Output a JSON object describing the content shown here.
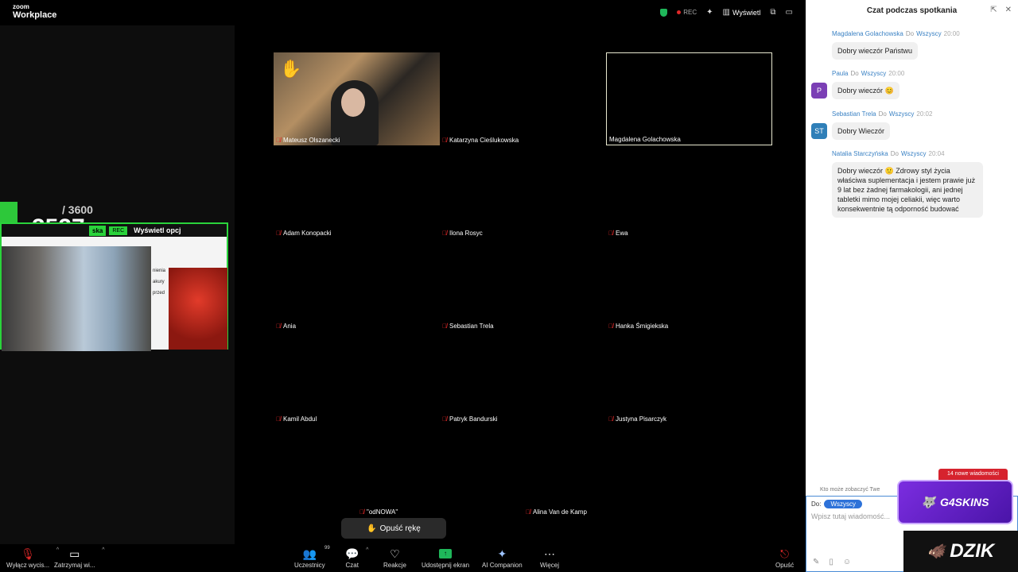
{
  "topbar": {
    "brand_small": "zoom",
    "brand_big": "Workplace",
    "rec": "REC",
    "view": "Wyświetl"
  },
  "overlay": {
    "counter_total": "/ 3600",
    "counter_now": "3537",
    "mini_name": "ska",
    "mini_rec": "REC",
    "mini_opts": "Wyświetl opcj",
    "doc_lines": [
      "nienia",
      "akury",
      "przed"
    ]
  },
  "participants": [
    {
      "name": "Mateusz Olszanecki",
      "hand": "✋"
    },
    {
      "name": "Katarzyna Cieślukowska"
    },
    {
      "name": "Magdalena Golachowska"
    },
    {
      "name": "Adam Konopacki"
    },
    {
      "name": "Ilona Rosyc"
    },
    {
      "name": "Ewa"
    },
    {
      "name": "Ania"
    },
    {
      "name": "Sebastian Trela"
    },
    {
      "name": "Hanka Śmigiekska"
    },
    {
      "name": "Kamil Abdul"
    },
    {
      "name": "Patryk Bandurski"
    },
    {
      "name": "Justyna Pisarczyk"
    },
    {
      "name": "\"odNOWA\""
    },
    {
      "name": "Alina Van de Kamp"
    }
  ],
  "lower_hand": "Opuść rękę",
  "toolbar": {
    "mute": "Wyłącz wycis...",
    "video": "Zatrzymaj wi...",
    "participants": "Uczestnicy",
    "participants_count": "99",
    "chat": "Czat",
    "reactions": "Reakcje",
    "share": "Udostępnij ekran",
    "ai": "AI Companion",
    "more": "Więcej",
    "leave": "Opuść"
  },
  "chat": {
    "title": "Czat podczas spotkania",
    "to_word": "Do",
    "messages": [
      {
        "sender": "Magdalena Golachowska",
        "to": "Wszyscy",
        "time": "20:00",
        "text": "Dobry wieczór Państwu",
        "avatar": ""
      },
      {
        "sender": "Paula",
        "to": "Wszyscy",
        "time": "20:00",
        "text": "Dobry wieczór 😊",
        "avatar": "P",
        "avatar_color": "#7b3fb5"
      },
      {
        "sender": "Sebastian Trela",
        "to": "Wszyscy",
        "time": "20:02",
        "text": "Dobry Wieczór",
        "avatar": "ST",
        "avatar_color": "#2f7fb8"
      },
      {
        "sender": "Natalia Starczyńska",
        "to": "Wszyscy",
        "time": "20:04",
        "text": "Dobry wieczór 🙂 Zdrowy styl życia właściwa suplementacja i jestem prawie już 9 lat bez żadnej farmakologii, ani jednej tabletki mimo mojej celiakii, więc warto konsekwentnie tą odporność budować",
        "avatar": ""
      }
    ],
    "new_messages": "14 nowe wiadomości",
    "who_sees": "Kto może zobaczyć Twe",
    "to_label": "Do:",
    "to_value": "Wszyscy",
    "placeholder": "Wpisz tutaj wiadomość..."
  },
  "stream": {
    "g4": "G4SKINS",
    "dzik": "DZIK"
  }
}
